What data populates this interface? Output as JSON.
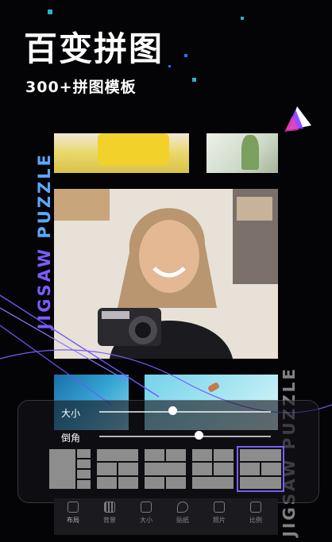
{
  "header": {
    "title": "百变拼图",
    "subtitle": "300+拼图模板"
  },
  "vertical_texts": {
    "left_part1": "JIGSAW",
    "left_part2": " PUZZLE",
    "right": "JIGSAW PUZZLE"
  },
  "sliders": [
    {
      "label": "大小",
      "value": 0.43
    },
    {
      "label": "倒角",
      "value": 0.58
    }
  ],
  "layouts": [
    {
      "name": "layout-1",
      "selected": false
    },
    {
      "name": "layout-2",
      "selected": false
    },
    {
      "name": "layout-3",
      "selected": false
    },
    {
      "name": "layout-4",
      "selected": false
    },
    {
      "name": "layout-5",
      "selected": true
    }
  ],
  "tabs": [
    {
      "label": "布局",
      "icon": "layout-icon"
    },
    {
      "label": "背景",
      "icon": "grid-icon"
    },
    {
      "label": "大小",
      "icon": "resize-icon"
    },
    {
      "label": "贴纸",
      "icon": "sticker-icon"
    },
    {
      "label": "照片",
      "icon": "photo-icon"
    },
    {
      "label": "比例",
      "icon": "ratio-icon"
    }
  ],
  "colors": {
    "accent": "#7c5cff",
    "accent2": "#5aa8ff",
    "background": "#040406"
  }
}
